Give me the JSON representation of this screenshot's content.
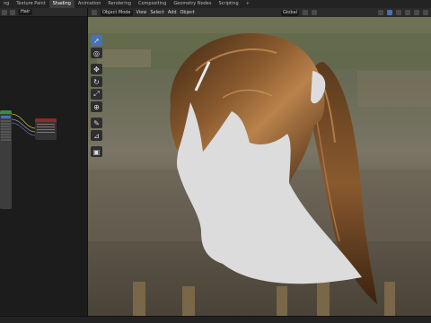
{
  "topbar": {
    "tabs": [
      {
        "label": "ng",
        "active": false
      },
      {
        "label": "Texture Paint",
        "active": false
      },
      {
        "label": "Shading",
        "active": true
      },
      {
        "label": "Animation",
        "active": false
      },
      {
        "label": "Rendering",
        "active": false
      },
      {
        "label": "Compositing",
        "active": false
      },
      {
        "label": "Geometry Nodes",
        "active": false
      },
      {
        "label": "Scripting",
        "active": false
      }
    ],
    "add_tab": "+"
  },
  "node_editor": {
    "material_name": "Hair"
  },
  "viewport": {
    "mode": "Object Mode",
    "menus": [
      "View",
      "Select",
      "Add",
      "Object"
    ],
    "transform_orientation": "Global",
    "tools": [
      {
        "name": "select-box",
        "glyph": "➚"
      },
      {
        "name": "cursor",
        "glyph": "◎"
      },
      {
        "name": "move",
        "glyph": "✥"
      },
      {
        "name": "rotate",
        "glyph": "↻"
      },
      {
        "name": "scale",
        "glyph": "⤢"
      },
      {
        "name": "transform",
        "glyph": "⊕"
      },
      {
        "name": "annotate",
        "glyph": "✎"
      },
      {
        "name": "measure",
        "glyph": "⊿"
      },
      {
        "name": "add-cube",
        "glyph": "▣"
      }
    ]
  },
  "colors": {
    "accent": "#4772b3",
    "hair_base": "#6b4526",
    "hair_highlight": "#b9824b",
    "head": "#dcdcdc"
  }
}
